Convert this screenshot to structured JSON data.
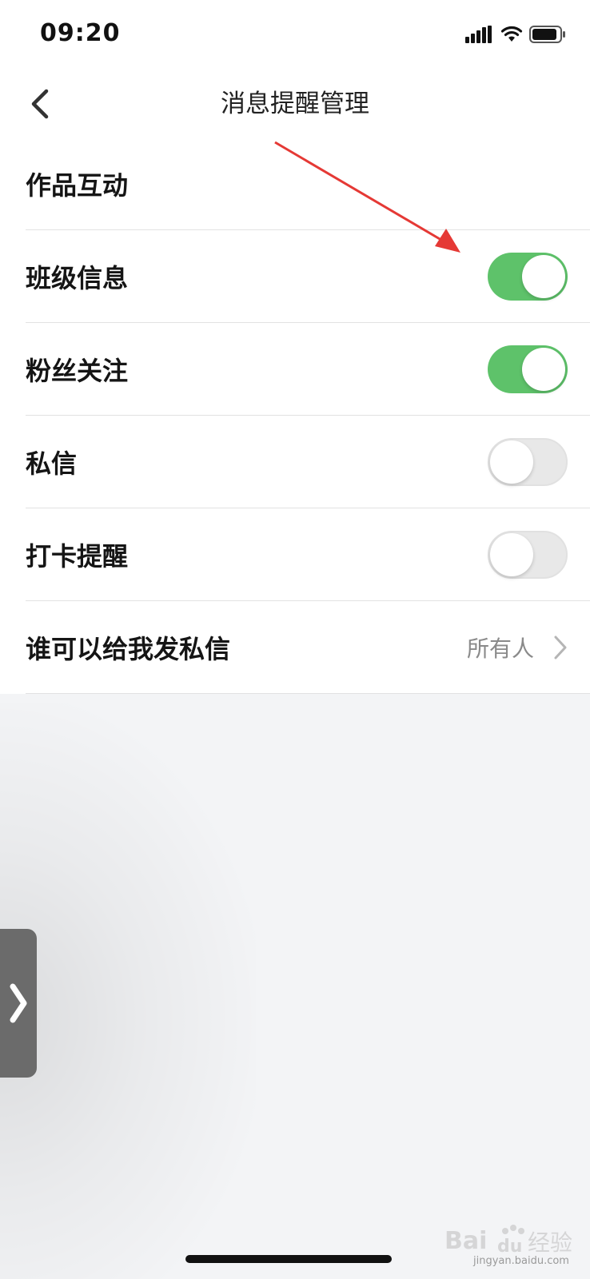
{
  "status_bar": {
    "time": "09:20"
  },
  "nav": {
    "title": "消息提醒管理",
    "back_icon": "chevron-left-icon"
  },
  "settings": {
    "rows": [
      {
        "label": "作品互动",
        "type": "header"
      },
      {
        "label": "班级信息",
        "type": "toggle",
        "enabled": true
      },
      {
        "label": "粉丝关注",
        "type": "toggle",
        "enabled": true
      },
      {
        "label": "私信",
        "type": "toggle",
        "enabled": false
      },
      {
        "label": "打卡提醒",
        "type": "toggle",
        "enabled": false
      },
      {
        "label": "谁可以给我发私信",
        "type": "select",
        "value": "所有人"
      }
    ]
  },
  "colors": {
    "toggle_on": "#5ec26a",
    "toggle_off": "#e8e8e8",
    "annotation_arrow": "#e53935",
    "page_background": "#f3f4f6"
  },
  "watermark": {
    "logo": "Bai du 经验",
    "sub": "jingyan.baidu.com"
  }
}
